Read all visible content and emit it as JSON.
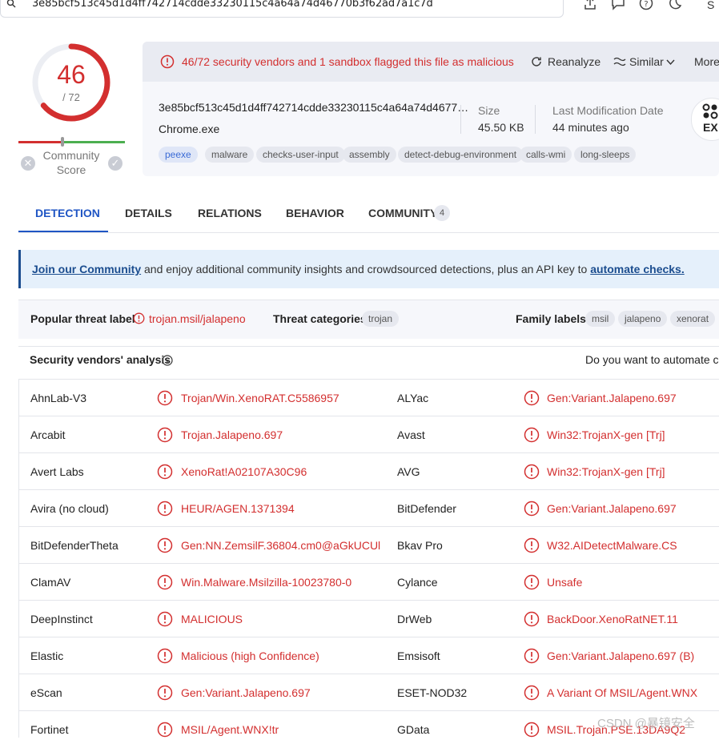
{
  "search": {
    "hash_query": "3e85bcf513c45d1d4ff742714cdde33230115c4a64a74d46770b3f62ad7a1c7d",
    "trailing_text": "S"
  },
  "score": {
    "detections": "46",
    "total": "/ 72",
    "community_label_1": "Community",
    "community_label_2": "Score",
    "fraction": 0.639
  },
  "alert": {
    "text": "46/72 security vendors and 1 sandbox flagged this file as malicious"
  },
  "actions": {
    "reanalyze": "Reanalyze",
    "similar": "Similar",
    "more": "More"
  },
  "file": {
    "hash": "3e85bcf513c45d1d4ff742714cdde33230115c4a64a74d4677…",
    "name": "Chrome.exe",
    "size_label": "Size",
    "size_value": "45.50 KB",
    "mod_label": "Last Modification Date",
    "mod_value": "44 minutes ago",
    "badge_text": "EX"
  },
  "tags": [
    "peexe",
    "malware",
    "checks-user-input",
    "assembly",
    "detect-debug-environment",
    "calls-wmi",
    "long-sleeps"
  ],
  "tabs": [
    {
      "label": "DETECTION"
    },
    {
      "label": "DETAILS"
    },
    {
      "label": "RELATIONS"
    },
    {
      "label": "BEHAVIOR"
    },
    {
      "label": "COMMUNITY",
      "count": "4"
    }
  ],
  "banner": {
    "link1": "Join our Community",
    "middle": " and enjoy additional community insights and crowdsourced detections, plus an API key to ",
    "link2": "automate checks."
  },
  "threat": {
    "popular_label": "Popular threat label",
    "popular_value": "trojan.msil/jalapeno",
    "categories_label": "Threat categories",
    "categories": [
      "trojan"
    ],
    "family_label": "Family labels",
    "families": [
      "msil",
      "jalapeno",
      "xenorat"
    ]
  },
  "vendors_section": {
    "title": "Security vendors' analysis",
    "automate_prompt": "Do you want to automate che"
  },
  "vendors": [
    {
      "v1": "AhnLab-V3",
      "r1": "Trojan/Win.XenoRAT.C5586957",
      "v2": "ALYac",
      "r2": "Gen:Variant.Jalapeno.697"
    },
    {
      "v1": "Arcabit",
      "r1": "Trojan.Jalapeno.697",
      "v2": "Avast",
      "r2": "Win32:TrojanX-gen [Trj]"
    },
    {
      "v1": "Avert Labs",
      "r1": "XenoRat!A02107A30C96",
      "v2": "AVG",
      "r2": "Win32:TrojanX-gen [Trj]"
    },
    {
      "v1": "Avira (no cloud)",
      "r1": "HEUR/AGEN.1371394",
      "v2": "BitDefender",
      "r2": "Gen:Variant.Jalapeno.697"
    },
    {
      "v1": "BitDefenderTheta",
      "r1": "Gen:NN.ZemsilF.36804.cm0@aGkUCUl",
      "v2": "Bkav Pro",
      "r2": "W32.AIDetectMalware.CS"
    },
    {
      "v1": "ClamAV",
      "r1": "Win.Malware.Msilzilla-10023780-0",
      "v2": "Cylance",
      "r2": "Unsafe"
    },
    {
      "v1": "DeepInstinct",
      "r1": "MALICIOUS",
      "v2": "DrWeb",
      "r2": "BackDoor.XenoRatNET.11"
    },
    {
      "v1": "Elastic",
      "r1": "Malicious (high Confidence)",
      "v2": "Emsisoft",
      "r2": "Gen:Variant.Jalapeno.697 (B)"
    },
    {
      "v1": "eScan",
      "r1": "Gen:Variant.Jalapeno.697",
      "v2": "ESET-NOD32",
      "r2": "A Variant Of MSIL/Agent.WNX"
    },
    {
      "v1": "Fortinet",
      "r1": "MSIL/Agent.WNX!tr",
      "v2": "GData",
      "r2": "MSIL.Trojan.PSE.13DA9Q2"
    }
  ],
  "watermark": "CSDN @暴镜安全",
  "colors": {
    "malicious": "#d32f2f",
    "accent": "#1f55c4",
    "banner_bg": "#e5f0fb"
  }
}
